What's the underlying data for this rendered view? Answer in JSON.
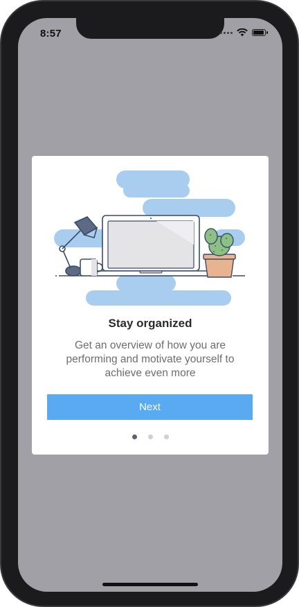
{
  "status_bar": {
    "time": "8:57",
    "battery_level": 0.95
  },
  "onboarding": {
    "title": "Stay organized",
    "subtitle": "Get an overview of how you are performing and motivate yourself to achieve even more",
    "next_label": "Next",
    "pager": {
      "page_count": 3,
      "current_page": 1
    }
  },
  "colors": {
    "overlay": "#a0a0a6",
    "button": "#59aaf0",
    "illustration_accent": "#a9cdef",
    "dot_active": "#5d6270",
    "dot_inactive": "#cfcfd4"
  },
  "icons": {
    "illustration": "laptop-desk-illustration",
    "wifi": "wifi-icon",
    "battery": "battery-icon",
    "signal": "cellular-signal-icon"
  }
}
